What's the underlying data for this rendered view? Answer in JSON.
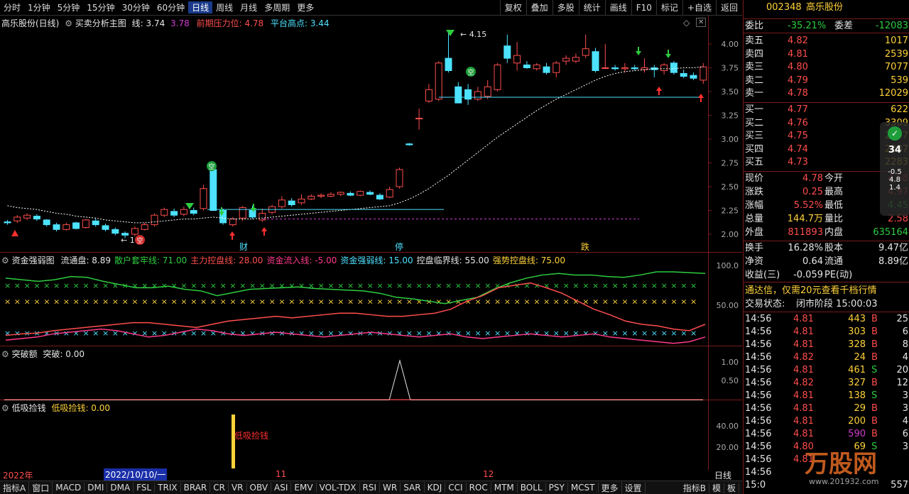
{
  "toolbar": {
    "periods": [
      "分时",
      "1分钟",
      "5分钟",
      "15分钟",
      "30分钟",
      "60分钟",
      "日线",
      "周线",
      "月线",
      "多周期",
      "更多"
    ],
    "active_period": "日线",
    "right_buttons": [
      "复权",
      "叠加",
      "多股",
      "统计",
      "画线",
      "F10",
      "标记",
      "+自选",
      "返回"
    ]
  },
  "main": {
    "stock_title": "高乐股份(日线)",
    "indicator_name": "买卖分析主图",
    "line_label": "线: 3.74",
    "val2": "3.78",
    "prev_pressure": "前期压力位: 4.78",
    "platform_high": "平台高点: 3.44",
    "price_axis": [
      "4.00",
      "3.75",
      "3.50",
      "3.25",
      "3.00",
      "2.75",
      "2.50",
      "2.25",
      "2.00"
    ],
    "high_marker": "4.15",
    "low_marker": "1",
    "tags": [
      "财",
      "停",
      "跌"
    ],
    "kong_label": "空"
  },
  "fund_panel": {
    "title": "资金强弱图",
    "items": [
      {
        "label": "流通盘: 8.89",
        "color": "#e6e6e6"
      },
      {
        "label": "散户套牢线: 71.00",
        "color": "#2ecc40"
      },
      {
        "label": "主力控盘线: 28.00",
        "color": "#ff4d4d"
      },
      {
        "label": "资金流入线: -5.00",
        "color": "#ff3a8a"
      },
      {
        "label": "资金强弱线: 15.00",
        "color": "#4de2ff"
      },
      {
        "label": "控盘临界线: 55.00",
        "color": "#e6e6e6"
      },
      {
        "label": "强势控盘线: 75.00",
        "color": "#ffd23a"
      }
    ],
    "axis": [
      "100.0",
      "50.00"
    ]
  },
  "break_panel": {
    "title": "突破额",
    "value": "突破: 0.00",
    "axis": [
      "1.00",
      "0.50"
    ]
  },
  "low_panel": {
    "title": "低吸捡钱",
    "value": "低吸捡钱: 0.00",
    "axis": [
      "40.00",
      "20.00"
    ],
    "bar_label": "低吸捡钱"
  },
  "datebar": {
    "year": "2022年",
    "date": "2022/10/10/一",
    "month11": "11",
    "month12": "12",
    "right": "日线"
  },
  "bottom_tabs": [
    "指标A",
    "窗口",
    "MACD",
    "DMI",
    "DMA",
    "FSL",
    "TRIX",
    "BRAR",
    "CR",
    "VR",
    "OBV",
    "ASI",
    "EMV",
    "VOL-TDX",
    "RSI",
    "WR",
    "SAR",
    "KDJ",
    "CCI",
    "ROC",
    "MTM",
    "BOLL",
    "PSY",
    "MCST",
    "更多",
    "设置"
  ],
  "bottom_right": [
    "指标B",
    "模",
    "板"
  ],
  "quote": {
    "code": "002348",
    "name": "高乐股份",
    "weibi_label": "委比",
    "weibi": "-35.21%",
    "weicha_label": "委差",
    "weicha": "-12083",
    "asks": [
      {
        "label": "卖五",
        "price": "4.82",
        "vol": "1017"
      },
      {
        "label": "卖四",
        "price": "4.81",
        "vol": "2539"
      },
      {
        "label": "卖三",
        "price": "4.80",
        "vol": "7077"
      },
      {
        "label": "卖二",
        "price": "4.79",
        "vol": "539"
      },
      {
        "label": "卖一",
        "price": "4.78",
        "vol": "12029"
      }
    ],
    "bids": [
      {
        "label": "买一",
        "price": "4.77",
        "vol": "622"
      },
      {
        "label": "买二",
        "price": "4.76",
        "vol": "3309"
      },
      {
        "label": "买三",
        "price": "4.75",
        "vol": "2097"
      },
      {
        "label": "买四",
        "price": "4.74",
        "vol": "2087"
      },
      {
        "label": "买五",
        "price": "4.73",
        "vol": "2283"
      }
    ],
    "stats": [
      {
        "l1": "现价",
        "v1": "4.78",
        "c1": "#ff4d4d",
        "l2": "今开",
        "v2": "4.58",
        "c2": "#ff4d4d"
      },
      {
        "l1": "涨跌",
        "v1": "0.25",
        "c1": "#ff4d4d",
        "l2": "最高",
        "v2": "4.97",
        "c2": "#ff4d4d"
      },
      {
        "l1": "涨幅",
        "v1": "5.52%",
        "c1": "#ff4d4d",
        "l2": "最低",
        "v2": "4.45",
        "c2": "#2ecc40"
      },
      {
        "l1": "总量",
        "v1": "144.7万",
        "c1": "#ffd23a",
        "l2": "量比",
        "v2": "2.58",
        "c2": "#ff4d4d"
      },
      {
        "l1": "外盘",
        "v1": "811893",
        "c1": "#ff4d4d",
        "l2": "内盘",
        "v2": "635164",
        "c2": "#2ecc40"
      }
    ],
    "stats2": [
      {
        "l1": "换手",
        "v1": "16.28%",
        "l2": "股本",
        "v2": "9.47亿"
      },
      {
        "l1": "净资",
        "v1": "0.64",
        "l2": "流通",
        "v2": "8.89亿"
      },
      {
        "l1": "收益(三)",
        "v1": "-0.059",
        "l2": "PE(动)",
        "v2": ""
      }
    ],
    "ad": "通达信，仅需20元查看千档行情",
    "status_label": "交易状态:",
    "status": "闭市阶段 15:00:03",
    "float_badge": "34",
    "float_rows": [
      "-0.5",
      "4.8",
      "1.4"
    ],
    "ticks": [
      {
        "t": "14:56",
        "p": "4.81",
        "v": "443",
        "s": "B",
        "n": "25"
      },
      {
        "t": "14:56",
        "p": "4.81",
        "v": "303",
        "s": "B",
        "n": "6"
      },
      {
        "t": "14:56",
        "p": "4.81",
        "v": "328",
        "s": "B",
        "n": "8"
      },
      {
        "t": "14:56",
        "p": "4.82",
        "v": "24",
        "s": "B",
        "n": "4"
      },
      {
        "t": "14:56",
        "p": "4.81",
        "v": "461",
        "s": "S",
        "n": "20"
      },
      {
        "t": "14:56",
        "p": "4.82",
        "v": "327",
        "s": "B",
        "n": "12"
      },
      {
        "t": "14:56",
        "p": "4.81",
        "v": "138",
        "s": "S",
        "n": "3"
      },
      {
        "t": "14:56",
        "p": "4.81",
        "v": "29",
        "s": "B",
        "n": "3"
      },
      {
        "t": "14:56",
        "p": "4.81",
        "v": "200",
        "s": "B",
        "n": "4"
      },
      {
        "t": "14:56",
        "p": "4.81",
        "v": "590",
        "s": "B",
        "n": "6"
      },
      {
        "t": "14:56",
        "p": "4.80",
        "v": "69",
        "s": "S",
        "n": "3"
      },
      {
        "t": "14:56",
        "p": "4.81",
        "v": "",
        "s": "",
        "n": ""
      },
      {
        "t": "14:56",
        "p": "",
        "v": "",
        "s": "",
        "n": ""
      },
      {
        "t": "15:0",
        "p": "",
        "v": "",
        "s": "",
        "n": "557"
      }
    ],
    "watermark": "万股网",
    "watermark_url": "www.201932.com"
  },
  "colors": {
    "up": "#ff4d4d",
    "down": "#4de2ff",
    "frame": "#7a1a1a",
    "ma": "#ffffff"
  }
}
